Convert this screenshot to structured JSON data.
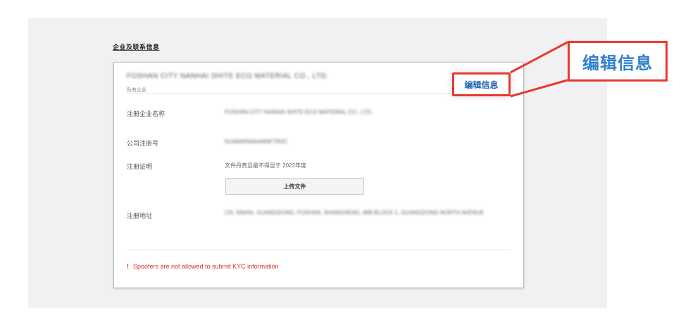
{
  "section": {
    "title": "企业及联系信息"
  },
  "card": {
    "company_name": "FOSHAN CITY NANHAI SHITE ECO MATERIAL CO., LTD.",
    "company_subtitle": "私有企业",
    "rows": [
      {
        "label": "注册企业名称",
        "value": "FOSHAN CITY NANHAI SHITE ECO MATERIAL CO., LTD."
      },
      {
        "label": "公司注册号",
        "value": "91440605MA4W6F7R2C"
      },
      {
        "label": "注册证明",
        "value": "文件丹真且最不得显于 2022年度"
      },
      {
        "label": "注册地址",
        "value": "CN, SINAN, GUANGDONG, FOSHAN, SHANGHENG, 888 BLOCK 1, GUANGDONG NORTH AVENUE"
      }
    ],
    "upload_label": "上传文件",
    "warning": "Spoofers are not allowed to submit KYC information",
    "edit_label": "编辑信息"
  },
  "callout": {
    "text": "编辑信息"
  },
  "colors": {
    "accent_red": "#e53a2e",
    "link_blue": "#1f5fb3",
    "callout_blue": "#2f80c9"
  }
}
